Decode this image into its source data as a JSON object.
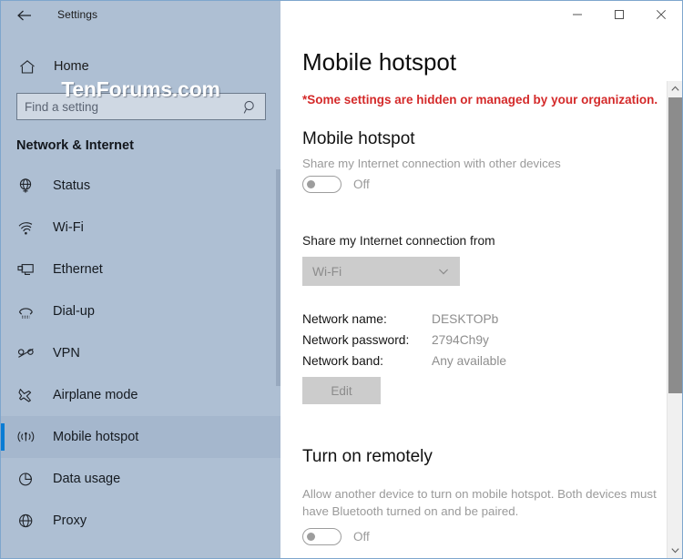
{
  "window": {
    "title": "Settings",
    "back_icon": "back-arrow-icon",
    "controls": {
      "minimize": "minimize-icon",
      "maximize": "maximize-icon",
      "close": "close-icon"
    }
  },
  "watermark": {
    "text": "TenForums.com"
  },
  "sidebar": {
    "home": {
      "label": "Home",
      "icon": "home-icon"
    },
    "search": {
      "value": "",
      "placeholder": "Find a setting",
      "icon": "search-icon"
    },
    "category": "Network & Internet",
    "items": [
      {
        "label": "Status",
        "icon": "globe-status-icon",
        "selected": false
      },
      {
        "label": "Wi-Fi",
        "icon": "wifi-icon",
        "selected": false
      },
      {
        "label": "Ethernet",
        "icon": "ethernet-icon",
        "selected": false
      },
      {
        "label": "Dial-up",
        "icon": "dialup-icon",
        "selected": false
      },
      {
        "label": "VPN",
        "icon": "vpn-icon",
        "selected": false
      },
      {
        "label": "Airplane mode",
        "icon": "airplane-icon",
        "selected": false
      },
      {
        "label": "Mobile hotspot",
        "icon": "hotspot-icon",
        "selected": true
      },
      {
        "label": "Data usage",
        "icon": "pie-chart-icon",
        "selected": false
      },
      {
        "label": "Proxy",
        "icon": "globe-icon",
        "selected": false
      }
    ]
  },
  "main": {
    "page_title": "Mobile hotspot",
    "org_note": "*Some settings are hidden or managed by your organization.",
    "hotspot": {
      "heading": "Mobile hotspot",
      "description": "Share my Internet connection with other devices",
      "toggle_state": "Off"
    },
    "share_from": {
      "label": "Share my Internet connection from",
      "selected": "Wi-Fi",
      "chevron_icon": "chevron-down-icon"
    },
    "network_details": [
      {
        "label": "Network name:",
        "value": "DESKTOPb"
      },
      {
        "label": "Network password:",
        "value": "2794Ch9y"
      },
      {
        "label": "Network band:",
        "value": "Any available"
      }
    ],
    "edit_button": "Edit",
    "remote": {
      "heading": "Turn on remotely",
      "description": "Allow another device to turn on mobile hotspot. Both devices must have Bluetooth turned on and be paired.",
      "toggle_state": "Off"
    },
    "scrollbar": {
      "up_icon": "scroll-up-icon",
      "down_icon": "scroll-down-icon"
    }
  },
  "colors": {
    "sidebar_bg": "#aebfd3",
    "accent": "#0a7cd4",
    "warning_text": "#d42a2a",
    "disabled_fill": "#cccccc"
  }
}
